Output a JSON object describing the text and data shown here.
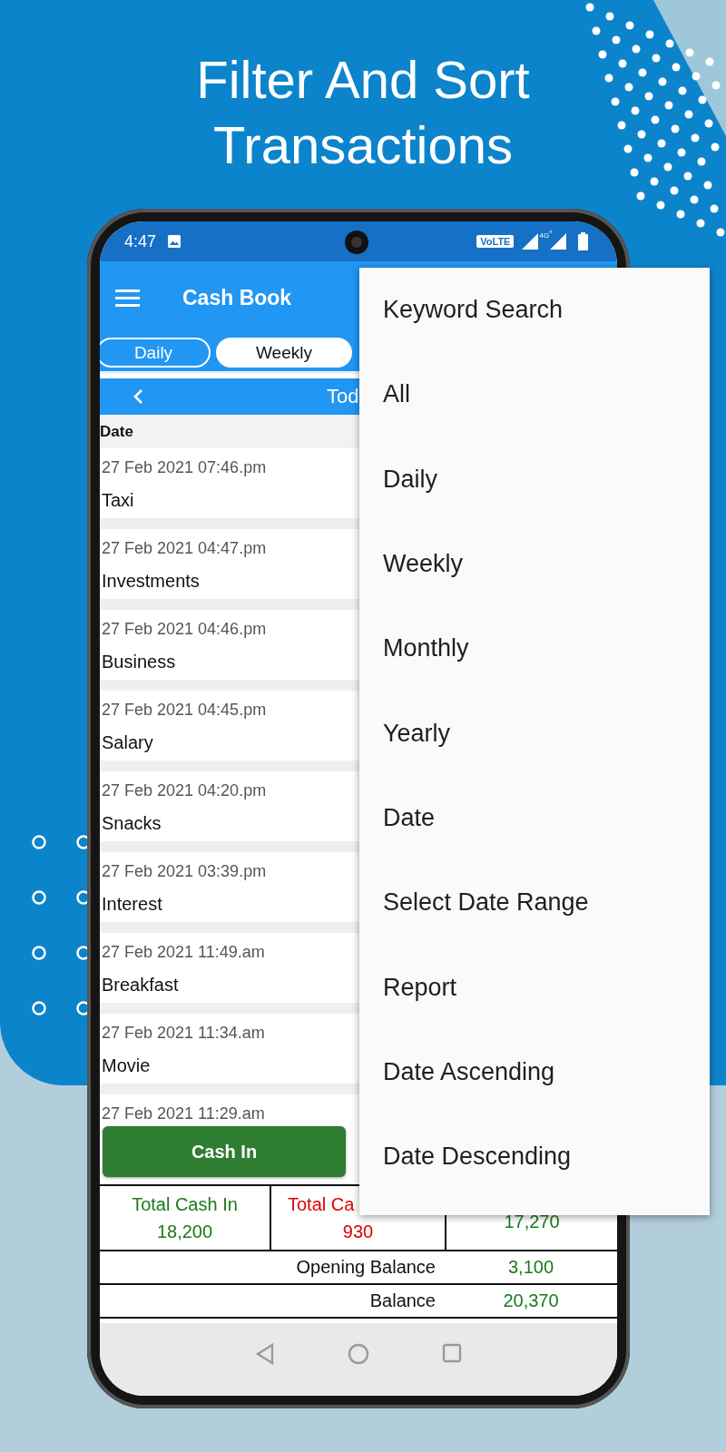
{
  "headline": "Filter And Sort Transactions",
  "status_bar": {
    "time": "4:47",
    "network_badge": "VoLTE",
    "network_type": "4G$^{+}$"
  },
  "app_bar": {
    "title": "Cash Book"
  },
  "tabs": [
    {
      "label": "Daily",
      "selected": false
    },
    {
      "label": "Weekly",
      "selected": true
    }
  ],
  "period_nav": {
    "label": "Tod"
  },
  "table": {
    "columns": [
      "Date"
    ],
    "rows": [
      {
        "date": "27 Feb 2021 07:46.pm",
        "category": "Taxi"
      },
      {
        "date": "27 Feb 2021 04:47.pm",
        "category": "Investments"
      },
      {
        "date": "27 Feb 2021 04:46.pm",
        "category": "Business"
      },
      {
        "date": "27 Feb 2021 04:45.pm",
        "category": "Salary"
      },
      {
        "date": "27 Feb 2021 04:20.pm",
        "category": "Snacks"
      },
      {
        "date": "27 Feb 2021 03:39.pm",
        "category": "Interest"
      },
      {
        "date": "27 Feb 2021 11:49.am",
        "category": "Breakfast"
      },
      {
        "date": "27 Feb 2021 11:34.am",
        "category": "Movie"
      },
      {
        "date": "27 Feb 2021 11:29.am"
      }
    ]
  },
  "cash_in_button": "Cash In",
  "totals": [
    {
      "kind": "in",
      "label": "Total Cash In",
      "value": "18,200"
    },
    {
      "kind": "out",
      "label": "Total Ca",
      "value": "930"
    },
    {
      "kind": "net",
      "value": "17,270"
    }
  ],
  "opening_balance": {
    "label": "Opening Balance",
    "value": "3,100"
  },
  "balance": {
    "label": "Balance",
    "value": "20,370"
  },
  "menu": {
    "items": [
      "Keyword Search",
      "All",
      "Daily",
      "Weekly",
      "Monthly",
      "Yearly",
      "Date",
      "Select Date Range",
      "Report",
      "Date Ascending",
      "Date Descending"
    ]
  }
}
